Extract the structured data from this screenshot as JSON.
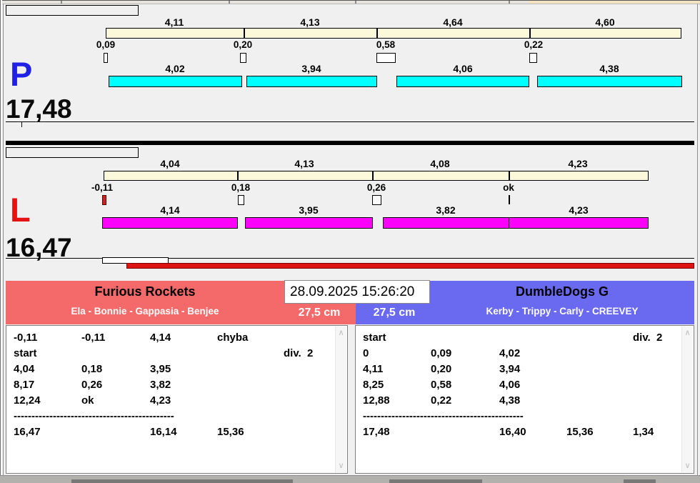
{
  "colors": {
    "background": "#f0f0f0",
    "cream_lane": "#fcf9da",
    "cyan_bar": "#00ffff",
    "magenta_bar": "#ff00ff",
    "salmon_header": "#f46a6a",
    "blue_header": "#6a6af0",
    "p_letter": "#2020e6",
    "l_letter": "#e61212",
    "progress_red": "#dd1414",
    "fault_marker": "#cc2222"
  },
  "lights": {
    "colors": [
      "#ff0000",
      "#ffff00",
      "#ffff00",
      "#00cc33"
    ]
  },
  "panel_p": {
    "letter": "P",
    "total": "17,48",
    "top_segments": [
      "4,11",
      "4,13",
      "4,64",
      "4,60"
    ],
    "splits": [
      "0,09",
      "0,20",
      "0,58",
      "0,22"
    ],
    "bottom_segments": [
      "4,02",
      "3,94",
      "4,06",
      "4,38"
    ]
  },
  "panel_l": {
    "letter": "L",
    "total": "16,47",
    "top_segments": [
      "4,04",
      "4,13",
      "4,08",
      "4,23"
    ],
    "splits": [
      "-0,11",
      "0,18",
      "0,26",
      "ok"
    ],
    "bottom_segments": [
      "4,14",
      "3,95",
      "3,82",
      "4,23"
    ]
  },
  "scoreboard": {
    "datetime": "28.09.2025 15:26:20",
    "left": {
      "team": "Furious Rockets",
      "dogs": "Ela - Bonnie - Gappasia - Benjee",
      "height": "27,5 cm",
      "rows": [
        {
          "cells": [
            {
              "col": 0,
              "text": "-0,11"
            },
            {
              "col": 1,
              "text": "-0,11"
            },
            {
              "col": 2,
              "text": "4,14"
            },
            {
              "col": 3,
              "text": "chyba"
            }
          ]
        },
        {
          "cells": [
            {
              "col": 0,
              "text": "start"
            },
            {
              "col": 4,
              "text": "div.  2"
            }
          ]
        },
        {
          "cells": [
            {
              "col": 0,
              "text": "4,04"
            },
            {
              "col": 1,
              "text": "0,18"
            },
            {
              "col": 2,
              "text": "3,95"
            }
          ]
        },
        {
          "cells": [
            {
              "col": 0,
              "text": "8,17"
            },
            {
              "col": 1,
              "text": "0,26"
            },
            {
              "col": 2,
              "text": "3,82"
            }
          ]
        },
        {
          "cells": [
            {
              "col": 0,
              "text": "12,24"
            },
            {
              "col": 1,
              "text": "ok"
            },
            {
              "col": 2,
              "text": "4,23"
            }
          ]
        },
        {
          "cells": [
            {
              "col": 0,
              "text": "---------------------------------------------"
            }
          ]
        },
        {
          "cells": [
            {
              "col": 0,
              "text": "16,47"
            },
            {
              "col": 2,
              "text": "16,14"
            },
            {
              "col": 3,
              "text": "15,36"
            }
          ]
        }
      ]
    },
    "right": {
      "team": "DumbleDogs G",
      "dogs": "Kerby - Trippy - Carly - CREEVEY",
      "height": "27,5 cm",
      "rows": [
        {
          "cells": [
            {
              "col": 0,
              "text": "start"
            },
            {
              "col": 4,
              "text": "div.  2"
            }
          ]
        },
        {
          "cells": [
            {
              "col": 0,
              "text": "0"
            },
            {
              "col": 1,
              "text": "0,09"
            },
            {
              "col": 2,
              "text": "4,02"
            }
          ]
        },
        {
          "cells": [
            {
              "col": 0,
              "text": "4,11"
            },
            {
              "col": 1,
              "text": "0,20"
            },
            {
              "col": 2,
              "text": "3,94"
            }
          ]
        },
        {
          "cells": [
            {
              "col": 0,
              "text": "8,25"
            },
            {
              "col": 1,
              "text": "0,58"
            },
            {
              "col": 2,
              "text": "4,06"
            }
          ]
        },
        {
          "cells": [
            {
              "col": 0,
              "text": "12,88"
            },
            {
              "col": 1,
              "text": "0,22"
            },
            {
              "col": 2,
              "text": "4,38"
            }
          ]
        },
        {
          "cells": [
            {
              "col": 0,
              "text": "---------------------------------------------"
            }
          ]
        },
        {
          "cells": [
            {
              "col": 0,
              "text": "17,48"
            },
            {
              "col": 2,
              "text": "16,40"
            },
            {
              "col": 3,
              "text": "15,36"
            },
            {
              "col": 4,
              "text": "1,34"
            }
          ]
        }
      ]
    }
  },
  "icons": {
    "scroll_up": "∧",
    "scroll_down": "∨"
  }
}
